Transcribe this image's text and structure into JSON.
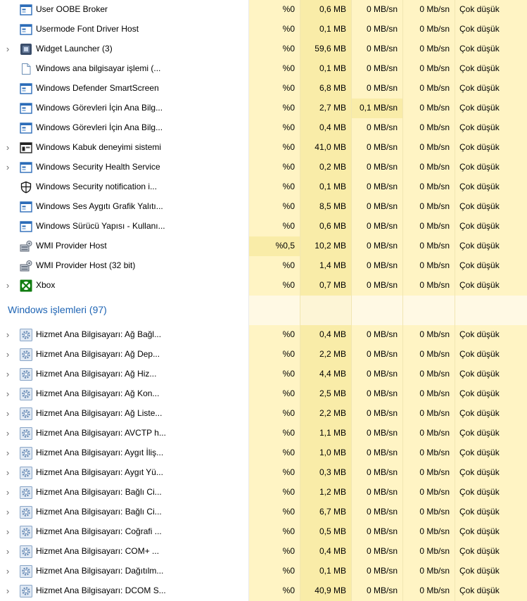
{
  "rows_top": [
    {
      "name": "User OOBE Broker",
      "icon": "app-window-icon",
      "expandable": false,
      "cpu": "%0",
      "mem": "0,6 MB",
      "disk": "0 MB/sn",
      "net": "0 Mb/sn",
      "power": "Çok düşük"
    },
    {
      "name": "Usermode Font Driver Host",
      "icon": "app-window-icon",
      "expandable": false,
      "cpu": "%0",
      "mem": "0,1 MB",
      "disk": "0 MB/sn",
      "net": "0 Mb/sn",
      "power": "Çok düşük"
    },
    {
      "name": "Widget Launcher (3)",
      "icon": "widget-icon",
      "expandable": true,
      "cpu": "%0",
      "mem": "59,6 MB",
      "disk": "0 MB/sn",
      "net": "0 Mb/sn",
      "power": "Çok düşük"
    },
    {
      "name": "Windows ana bilgisayar işlemi (...",
      "icon": "document-icon",
      "expandable": false,
      "cpu": "%0",
      "mem": "0,1 MB",
      "disk": "0 MB/sn",
      "net": "0 Mb/sn",
      "power": "Çok düşük"
    },
    {
      "name": "Windows Defender SmartScreen",
      "icon": "app-window-icon",
      "expandable": false,
      "cpu": "%0",
      "mem": "6,8 MB",
      "disk": "0 MB/sn",
      "net": "0 Mb/sn",
      "power": "Çok düşük"
    },
    {
      "name": "Windows Görevleri İçin Ana Bilg...",
      "icon": "app-window-icon",
      "expandable": false,
      "cpu": "%0",
      "mem": "2,7 MB",
      "disk": "0,1 MB/sn",
      "net": "0 Mb/sn",
      "power": "Çok düşük",
      "disk_hl": true
    },
    {
      "name": "Windows Görevleri İçin Ana Bilg...",
      "icon": "app-window-icon",
      "expandable": false,
      "cpu": "%0",
      "mem": "0,4 MB",
      "disk": "0 MB/sn",
      "net": "0 Mb/sn",
      "power": "Çok düşük"
    },
    {
      "name": "Windows Kabuk deneyimi sistemi",
      "icon": "shell-icon",
      "expandable": true,
      "cpu": "%0",
      "mem": "41,0 MB",
      "disk": "0 MB/sn",
      "net": "0 Mb/sn",
      "power": "Çok düşük"
    },
    {
      "name": "Windows Security Health Service",
      "icon": "app-window-icon",
      "expandable": true,
      "cpu": "%0",
      "mem": "0,2 MB",
      "disk": "0 MB/sn",
      "net": "0 Mb/sn",
      "power": "Çok düşük"
    },
    {
      "name": "Windows Security notification i...",
      "icon": "shield-icon",
      "expandable": false,
      "cpu": "%0",
      "mem": "0,1 MB",
      "disk": "0 MB/sn",
      "net": "0 Mb/sn",
      "power": "Çok düşük"
    },
    {
      "name": "Windows Ses Aygıtı Grafik Yalıtı...",
      "icon": "app-window-icon",
      "expandable": false,
      "cpu": "%0",
      "mem": "8,5 MB",
      "disk": "0 MB/sn",
      "net": "0 Mb/sn",
      "power": "Çok düşük"
    },
    {
      "name": "Windows Sürücü Yapısı - Kullanı...",
      "icon": "app-window-icon",
      "expandable": false,
      "cpu": "%0",
      "mem": "0,6 MB",
      "disk": "0 MB/sn",
      "net": "0 Mb/sn",
      "power": "Çok düşük"
    },
    {
      "name": "WMI Provider Host",
      "icon": "wmi-icon",
      "expandable": false,
      "cpu": "%0,5",
      "mem": "10,2 MB",
      "disk": "0 MB/sn",
      "net": "0 Mb/sn",
      "power": "Çok düşük",
      "cpu_hl": true
    },
    {
      "name": "WMI Provider Host (32 bit)",
      "icon": "wmi-icon",
      "expandable": false,
      "cpu": "%0",
      "mem": "1,4 MB",
      "disk": "0 MB/sn",
      "net": "0 Mb/sn",
      "power": "Çok düşük"
    },
    {
      "name": "Xbox",
      "icon": "xbox-icon",
      "expandable": true,
      "cpu": "%0",
      "mem": "0,7 MB",
      "disk": "0 MB/sn",
      "net": "0 Mb/sn",
      "power": "Çok düşük"
    }
  ],
  "group": {
    "title": "Windows işlemleri (97)"
  },
  "rows_bottom": [
    {
      "name": "Hizmet Ana Bilgisayarı: Ağ Bağl...",
      "icon": "gear-icon",
      "expandable": true,
      "cpu": "%0",
      "mem": "0,4 MB",
      "disk": "0 MB/sn",
      "net": "0 Mb/sn",
      "power": "Çok düşük"
    },
    {
      "name": "Hizmet Ana Bilgisayarı: Ağ Dep...",
      "icon": "gear-icon",
      "expandable": true,
      "cpu": "%0",
      "mem": "2,2 MB",
      "disk": "0 MB/sn",
      "net": "0 Mb/sn",
      "power": "Çok düşük"
    },
    {
      "name": "Hizmet Ana Bilgisayarı: Ağ Hiz...",
      "icon": "gear-icon",
      "expandable": true,
      "cpu": "%0",
      "mem": "4,4 MB",
      "disk": "0 MB/sn",
      "net": "0 Mb/sn",
      "power": "Çok düşük"
    },
    {
      "name": "Hizmet Ana Bilgisayarı: Ağ Kon...",
      "icon": "gear-icon",
      "expandable": true,
      "cpu": "%0",
      "mem": "2,5 MB",
      "disk": "0 MB/sn",
      "net": "0 Mb/sn",
      "power": "Çok düşük"
    },
    {
      "name": "Hizmet Ana Bilgisayarı: Ağ Liste...",
      "icon": "gear-icon",
      "expandable": true,
      "cpu": "%0",
      "mem": "2,2 MB",
      "disk": "0 MB/sn",
      "net": "0 Mb/sn",
      "power": "Çok düşük"
    },
    {
      "name": "Hizmet Ana Bilgisayarı: AVCTP h...",
      "icon": "gear-icon",
      "expandable": true,
      "cpu": "%0",
      "mem": "1,1 MB",
      "disk": "0 MB/sn",
      "net": "0 Mb/sn",
      "power": "Çok düşük"
    },
    {
      "name": "Hizmet Ana Bilgisayarı: Aygıt İliş...",
      "icon": "gear-icon",
      "expandable": true,
      "cpu": "%0",
      "mem": "1,0 MB",
      "disk": "0 MB/sn",
      "net": "0 Mb/sn",
      "power": "Çok düşük"
    },
    {
      "name": "Hizmet Ana Bilgisayarı: Aygıt Yü...",
      "icon": "gear-icon",
      "expandable": true,
      "cpu": "%0",
      "mem": "0,3 MB",
      "disk": "0 MB/sn",
      "net": "0 Mb/sn",
      "power": "Çok düşük"
    },
    {
      "name": "Hizmet Ana Bilgisayarı: Bağlı Ci...",
      "icon": "gear-icon",
      "expandable": true,
      "cpu": "%0",
      "mem": "1,2 MB",
      "disk": "0 MB/sn",
      "net": "0 Mb/sn",
      "power": "Çok düşük"
    },
    {
      "name": "Hizmet Ana Bilgisayarı: Bağlı Ci...",
      "icon": "gear-icon",
      "expandable": true,
      "cpu": "%0",
      "mem": "6,7 MB",
      "disk": "0 MB/sn",
      "net": "0 Mb/sn",
      "power": "Çok düşük"
    },
    {
      "name": "Hizmet Ana Bilgisayarı: Coğrafi ...",
      "icon": "gear-icon",
      "expandable": true,
      "cpu": "%0",
      "mem": "0,5 MB",
      "disk": "0 MB/sn",
      "net": "0 Mb/sn",
      "power": "Çok düşük"
    },
    {
      "name": "Hizmet Ana Bilgisayarı: COM+ ...",
      "icon": "gear-icon",
      "expandable": true,
      "cpu": "%0",
      "mem": "0,4 MB",
      "disk": "0 MB/sn",
      "net": "0 Mb/sn",
      "power": "Çok düşük"
    },
    {
      "name": "Hizmet Ana Bilgisayarı: Dağıtılm...",
      "icon": "gear-icon",
      "expandable": true,
      "cpu": "%0",
      "mem": "0,1 MB",
      "disk": "0 MB/sn",
      "net": "0 Mb/sn",
      "power": "Çok düşük"
    },
    {
      "name": "Hizmet Ana Bilgisayarı: DCOM S...",
      "icon": "gear-icon",
      "expandable": true,
      "cpu": "%0",
      "mem": "40,9 MB",
      "disk": "0 MB/sn",
      "net": "0 Mb/sn",
      "power": "Çok düşük"
    }
  ],
  "colors": {
    "group_title": "#1e64b4",
    "heat_light": "#fff4c4",
    "heat_mid": "#f9eca8"
  }
}
